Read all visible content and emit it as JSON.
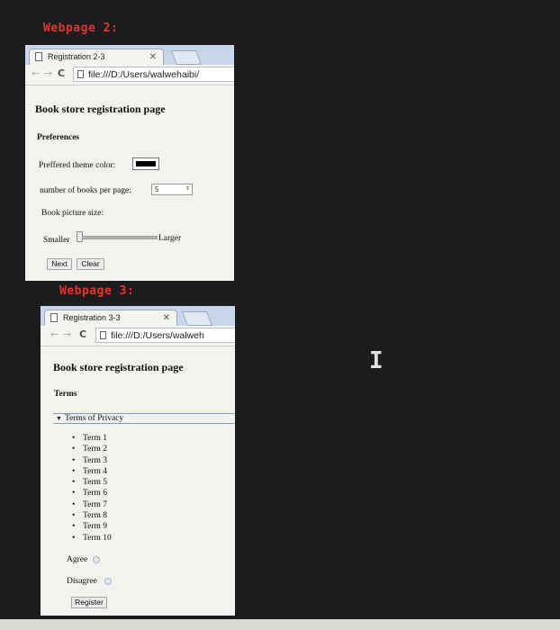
{
  "labels": {
    "webpage2": "Webpage 2:",
    "webpage3": "Webpage 3:"
  },
  "window2": {
    "tab_title": "Registration 2-3",
    "url": "file:///D:/Users/walwehaibi/",
    "heading": "Book store registration page",
    "section": "Preferences",
    "theme_color_label": "Preffered theme color:",
    "theme_color_value": "#000000",
    "books_per_page_label": "number of books per page:",
    "books_per_page_value": "5",
    "picture_size_label": "Book picture size:",
    "slider_min_label": "Smaller",
    "slider_max_label": "Larger",
    "slider_position": 0,
    "next_button": "Next",
    "clear_button": "Clear"
  },
  "window3": {
    "tab_title": "Registration 3-3",
    "url": "file:///D:/Users/walweh",
    "heading": "Book store registration page",
    "section": "Terms",
    "details_summary": "Terms of Privacy",
    "terms": [
      "Term 1",
      "Term 2",
      "Term 3",
      "Term 4",
      "Term 5",
      "Term 6",
      "Term 7",
      "Term 8",
      "Term 9",
      "Term 10"
    ],
    "agree_label": "Agree",
    "disagree_label": "Disagree",
    "register_button": "Register"
  },
  "icons": {
    "back": "back-arrow-icon",
    "forward": "forward-arrow-icon",
    "reload": "reload-icon",
    "close": "close-icon",
    "page": "page-icon",
    "cursor": "text-cursor-icon"
  },
  "colors": {
    "label_red": "#e8322a",
    "tabbar_blue": "#c7d6ea",
    "page_bg": "#f2f2ee"
  }
}
